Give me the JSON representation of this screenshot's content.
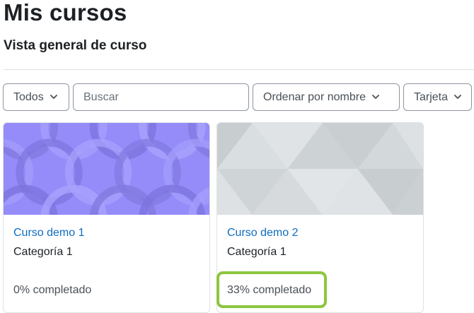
{
  "header": {
    "title": "Mis cursos",
    "section_title": "Vista general de curso"
  },
  "controls": {
    "filter": {
      "selected": "Todos",
      "icon": "chevron-down-icon"
    },
    "search": {
      "placeholder": "Buscar"
    },
    "sort": {
      "selected": "Ordenar por nombre",
      "icon": "chevron-down-icon"
    },
    "view": {
      "selected": "Tarjeta",
      "icon": "chevron-down-icon"
    }
  },
  "courses": [
    {
      "name": "Curso demo 1",
      "category": "Categoría 1",
      "progress_text": "0% completado",
      "progress": 0,
      "image_color": "#958cfa"
    },
    {
      "name": "Curso demo 2",
      "category": "Categoría 1",
      "progress_text": "33% completado",
      "progress": 33,
      "image_color": "#d5d9db"
    }
  ],
  "colors": {
    "link": "#0f6cbf",
    "highlight": "#8cc63f",
    "border": "#8f959e"
  }
}
